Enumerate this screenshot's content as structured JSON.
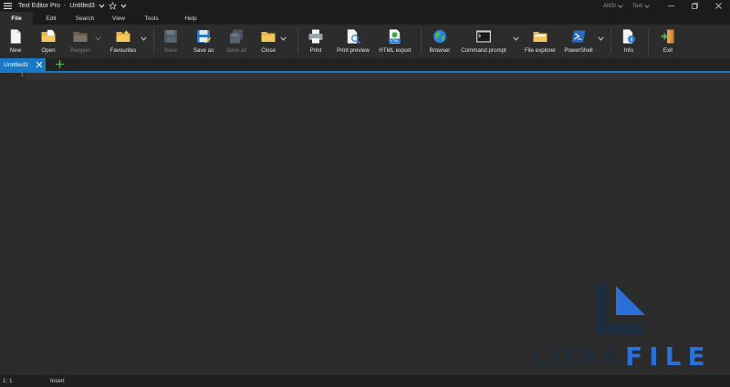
{
  "titlebar": {
    "app_name": "Text Editor Pro",
    "separator": "-",
    "document_name": "Untitled3",
    "encoding": "ANSI",
    "highlighter": "Text"
  },
  "menu": {
    "tabs": [
      {
        "label": "File",
        "active": true
      },
      {
        "label": "Edit",
        "active": false
      },
      {
        "label": "Search",
        "active": false
      },
      {
        "label": "View",
        "active": false
      },
      {
        "label": "Tools",
        "active": false
      },
      {
        "label": "Help",
        "active": false
      }
    ]
  },
  "ribbon": {
    "new": "New",
    "open": "Open",
    "reopen": "Reopen",
    "favourites": "Favourites",
    "save": "Save",
    "save_as": "Save as",
    "save_all": "Save all",
    "close": "Close",
    "print": "Print",
    "print_preview": "Print preview",
    "html_export": "HTML export",
    "browser": "Browser",
    "command_prompt": "Command prompt",
    "file_explorer": "File explorer",
    "powershell": "PowerShell",
    "info": "Info",
    "exit": "Exit"
  },
  "icons": {
    "html_export_badge": "HTML"
  },
  "doc_tabs": [
    {
      "label": "Untitled3",
      "active": true
    }
  ],
  "editor": {
    "line_numbers": [
      "1"
    ]
  },
  "watermark": {
    "part1": "LORA",
    "part2": "FILE"
  },
  "statusbar": {
    "position": "1: 1",
    "mode": "Insert"
  },
  "colors": {
    "accent": "#1779c8",
    "background": "#2b2b2b",
    "chrome": "#1b1b1b",
    "watermark_dark": "#1a2c3e",
    "watermark_blue": "#2a70d6"
  }
}
